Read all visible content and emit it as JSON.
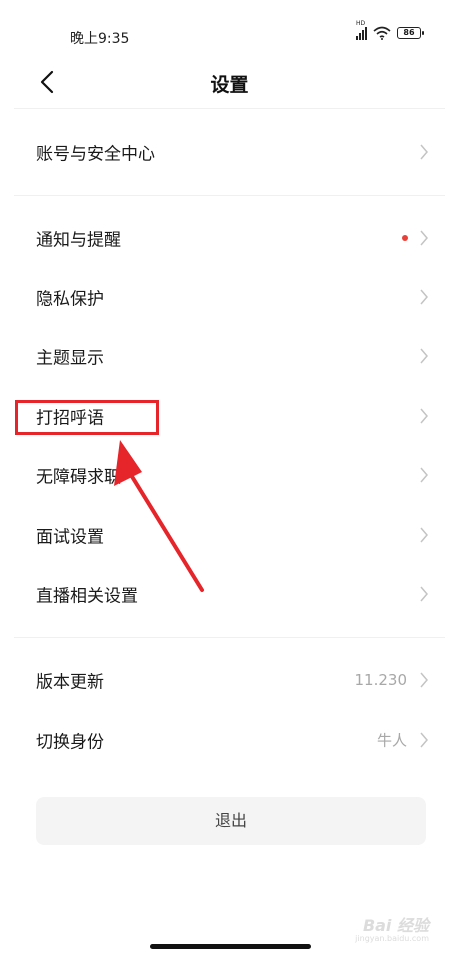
{
  "status_bar": {
    "time": "晚上9:35",
    "battery": "86",
    "signal_tag": "HD"
  },
  "nav": {
    "title": "设置"
  },
  "rows": [
    {
      "label": "账号与安全中心"
    },
    {
      "label": "通知与提醒"
    },
    {
      "label": "隐私保护"
    },
    {
      "label": "主题显示"
    },
    {
      "label": "打招呼语"
    },
    {
      "label": "无障碍求职"
    },
    {
      "label": "面试设置"
    },
    {
      "label": "直播相关设置"
    },
    {
      "label": "版本更新",
      "value": "11.230"
    },
    {
      "label": "切换身份",
      "value": "牛人"
    }
  ],
  "logout_label": "退出",
  "colors": {
    "accent_red": "#e5252a",
    "dot_red": "#e8413a",
    "text": "#1a1a1a",
    "muted": "#a8a8a8"
  },
  "watermark": {
    "title": "Bai 经验",
    "url": "jingyan.baidu.com"
  }
}
